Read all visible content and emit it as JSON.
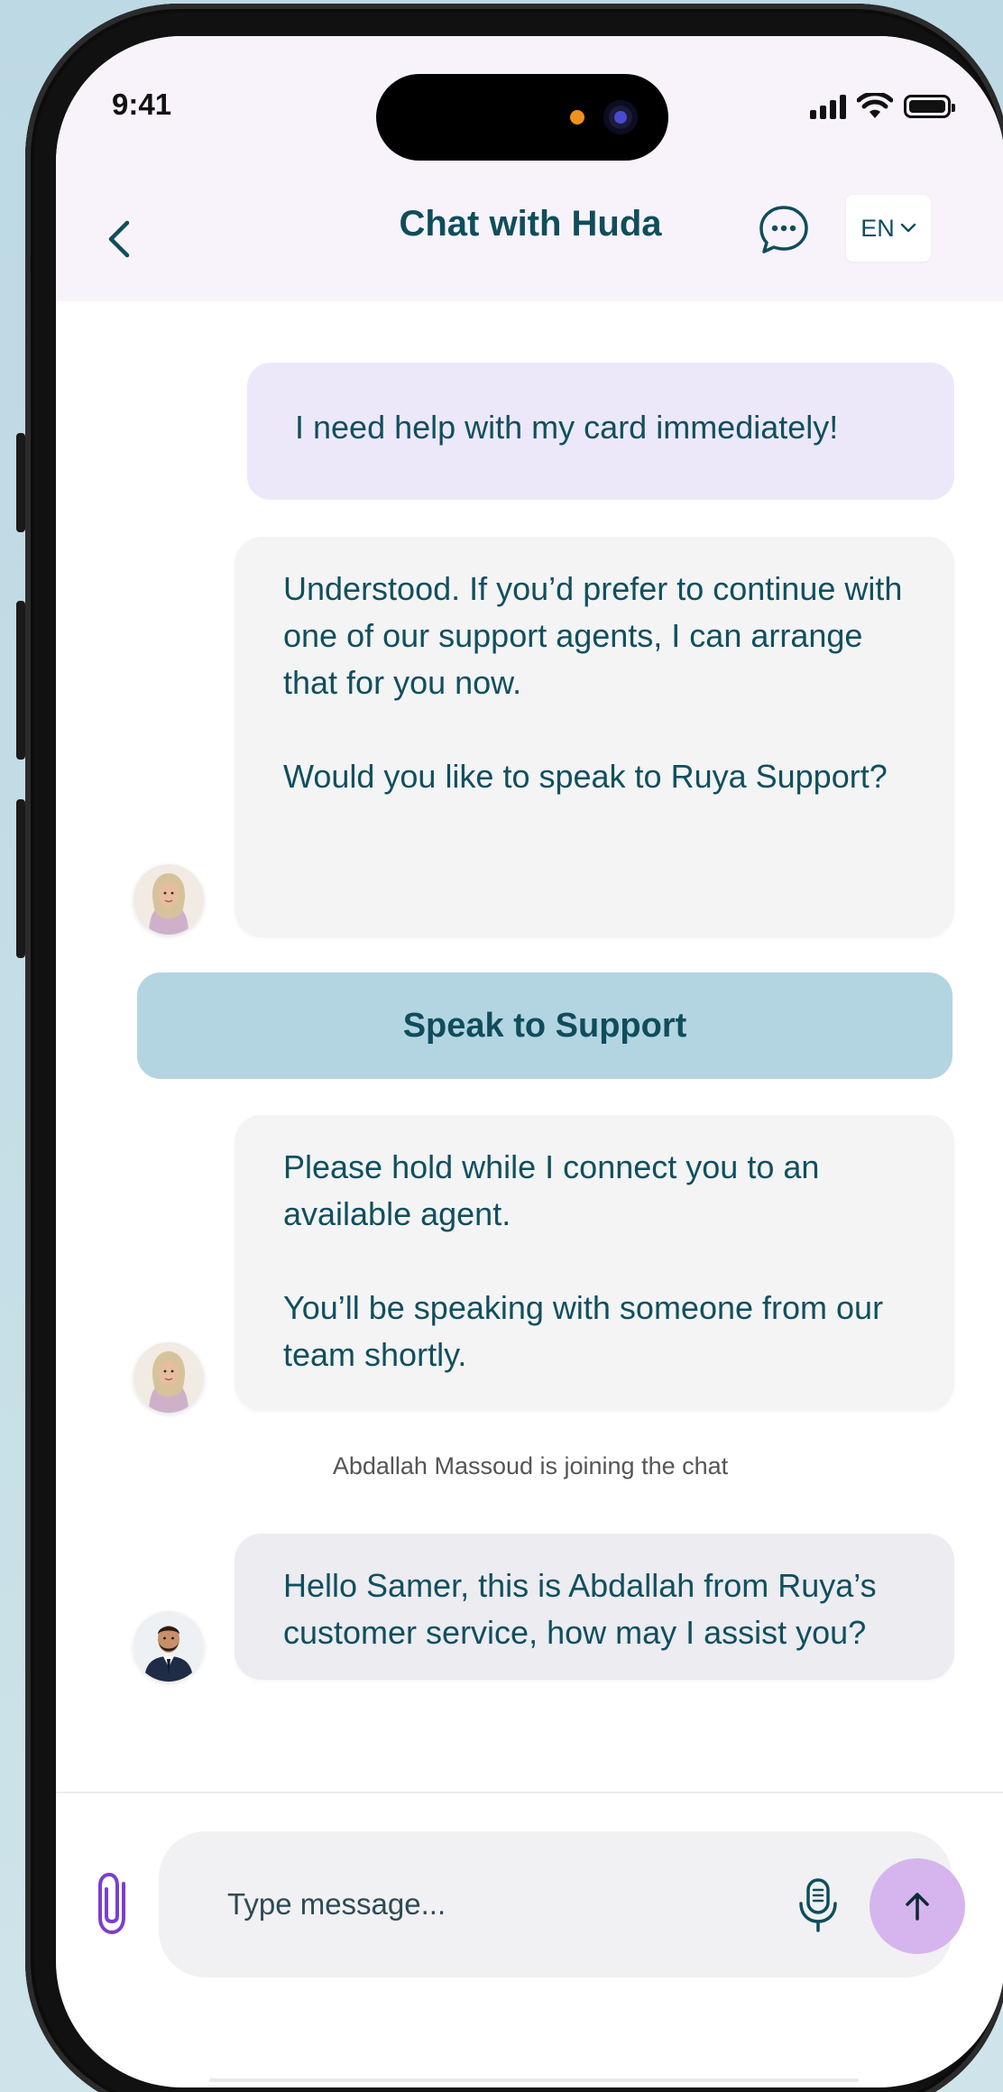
{
  "status_bar": {
    "time": "9:41"
  },
  "header": {
    "title": "Chat with Huda",
    "language": "EN"
  },
  "messages": {
    "user_1": "I need help with my card immediately!",
    "bot_1": {
      "line_1": "Understood. If you’d prefer to continue with one of our support agents, I can arrange that for you now.",
      "line_2": "Would you like to speak to Ruya Support?"
    },
    "action_button": "Speak to Support",
    "bot_2": {
      "line_1": "Please hold while I connect you to an available agent.",
      "line_2": "You’ll be speaking with someone from our team shortly."
    },
    "system_note": "Abdallah Massoud is joining the chat",
    "agent_1": "Hello Samer, this is Abdallah from Ruya’s customer service, how may I assist you?"
  },
  "composer": {
    "placeholder": "Type message..."
  },
  "colors": {
    "primary_text": "#0f4d5c",
    "user_bubble": "#ece8f9",
    "bot_bubble": "#f4f4f5",
    "action_button": "#b3d5e1",
    "send_button": "#d6b5ef",
    "accent_purple": "#7a3fd0"
  },
  "icons": {
    "back": "chevron-left-icon",
    "chat": "chat-bubble-icon",
    "language_dropdown": "chevron-down-icon",
    "attach": "paperclip-icon",
    "mic": "microphone-icon",
    "send": "arrow-up-icon"
  }
}
